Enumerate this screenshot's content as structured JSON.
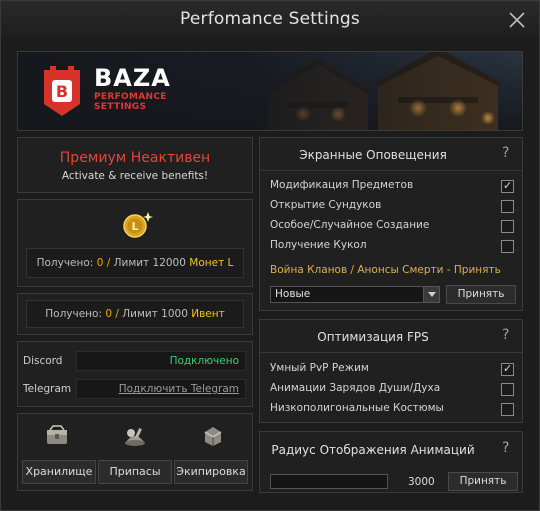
{
  "window": {
    "title": "Perfomance Settings"
  },
  "banner": {
    "logo_word": "BAZA",
    "logo_sub_line1": "PERFOMANCE",
    "logo_sub_line2": "SETTINGS"
  },
  "premium": {
    "title": "Премиум Неактивен",
    "subtitle": "Activate & receive benefits!"
  },
  "coins": {
    "received_label": "Получено:",
    "received_value": "0 /",
    "limit_label": "Лимит 12000",
    "currency": "Монет L"
  },
  "event": {
    "received_label": "Получено:",
    "received_value": "0 /",
    "limit_label": "Лимит 1000",
    "currency": "Ивент"
  },
  "connections": {
    "discord_label": "Discord",
    "discord_status": "Подключено",
    "telegram_label": "Telegram",
    "telegram_link": "Подключить Telegram"
  },
  "inventory": {
    "buttons": [
      {
        "label": "Хранилище",
        "icon": "storage-icon"
      },
      {
        "label": "Припасы",
        "icon": "supplies-icon"
      },
      {
        "label": "Экипировка",
        "icon": "equipment-icon"
      }
    ]
  },
  "notifications": {
    "title": "Экранные Оповещения",
    "help": "?",
    "options": [
      {
        "label": "Модификация Предметов",
        "checked": true
      },
      {
        "label": "Открытие Сундуков",
        "checked": false
      },
      {
        "label": "Особое/Случайное Создание",
        "checked": false
      },
      {
        "label": "Получение Кукол",
        "checked": false
      }
    ],
    "clan_label": "Война Кланов / Анонсы Смерти - Принять",
    "select_value": "Новые",
    "apply_label": "Принять"
  },
  "fps": {
    "title": "Оптимизация FPS",
    "help": "?",
    "options": [
      {
        "label": "Умный PvP Режим",
        "checked": true
      },
      {
        "label": "Анимации Зарядов Души/Духа",
        "checked": false
      },
      {
        "label": "Низкополигональные Костюмы",
        "checked": false
      }
    ]
  },
  "animation_radius": {
    "title": "Радиус Отображения Анимаций",
    "help": "?",
    "value": "3000",
    "apply_label": "Принять"
  },
  "colors": {
    "accent_red": "#e2453c",
    "gold": "#f0a500",
    "connected_green": "#3ccf6a"
  }
}
